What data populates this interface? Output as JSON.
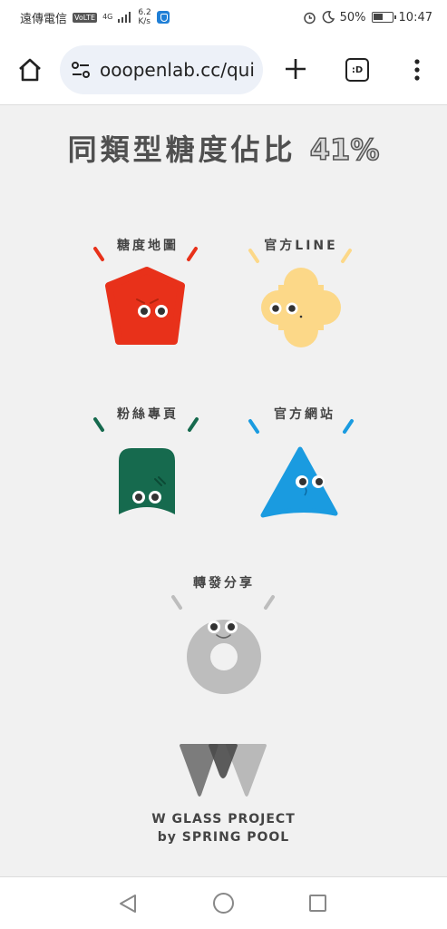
{
  "status_bar": {
    "carrier": "遠傳電信",
    "volte": "VoLTE",
    "network": "4G",
    "speed_value": "6.2",
    "speed_unit": "K/s",
    "battery": "50%",
    "time": "10:47"
  },
  "browser": {
    "url": "ooopenlab.cc/qui",
    "tabs_label": ":D"
  },
  "page": {
    "title": "同類型糖度佔比",
    "percent": "41%",
    "tiles": [
      {
        "label": "糖度地圖",
        "color": "#e8311a"
      },
      {
        "label": "官方LINE",
        "color": "#fcd888"
      },
      {
        "label": "粉絲專頁",
        "color": "#166a4e"
      },
      {
        "label": "官方網站",
        "color": "#1a9be0"
      },
      {
        "label": "轉發分享",
        "color": "#bdbdbd"
      }
    ],
    "footer_line1": "W GLASS PROJECT",
    "footer_line2": "by SPRING POOL"
  }
}
